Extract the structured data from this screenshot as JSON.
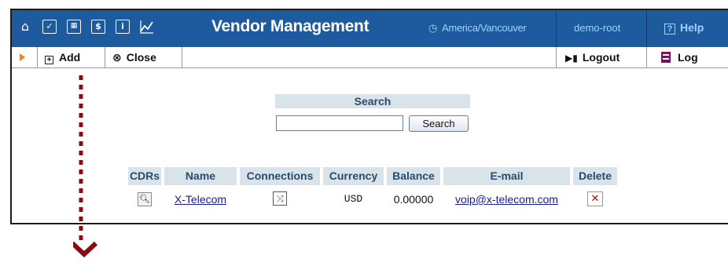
{
  "header": {
    "title": "Vendor Management",
    "timezone": "America/Vancouver",
    "user": "demo-root",
    "help_label": "Help",
    "icons": [
      "home-icon",
      "checkbox-icon",
      "grid-icon",
      "dollar-icon",
      "info-icon",
      "chart-icon"
    ]
  },
  "toolbar": {
    "add_label": "Add",
    "close_label": "Close",
    "logout_label": "Logout",
    "log_label": "Log"
  },
  "search": {
    "label": "Search",
    "value": "",
    "button_label": "Search"
  },
  "table": {
    "columns": [
      "CDRs",
      "Name",
      "Connections",
      "Currency",
      "Balance",
      "E-mail",
      "Delete"
    ],
    "rows": [
      {
        "name": "X-Telecom",
        "currency": "USD",
        "balance": "0.00000",
        "email": "voip@x-telecom.com"
      }
    ]
  },
  "colors": {
    "header_bg": "#1e5a9e",
    "header_accent": "#9fd0ff",
    "table_header_bg": "#d9e3ea",
    "arrow_color": "#8b0a14",
    "play_icon": "#f08a00"
  }
}
